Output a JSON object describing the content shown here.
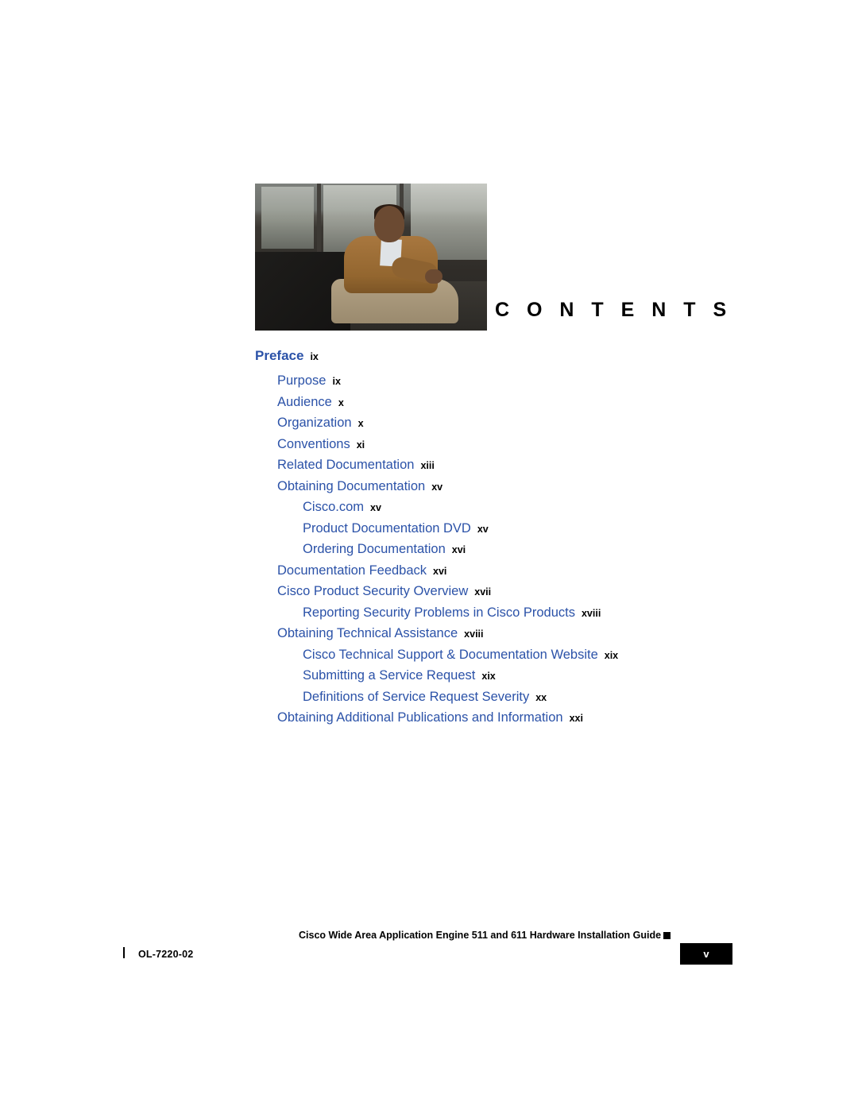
{
  "header": {
    "contents_heading": "C O N T E N T S",
    "photo_alt": "person-seated-photo"
  },
  "toc": {
    "entries": [
      {
        "title": "Preface",
        "page": "ix",
        "level": 0
      },
      {
        "title": "Purpose",
        "page": "ix",
        "level": 1
      },
      {
        "title": "Audience",
        "page": "x",
        "level": 1
      },
      {
        "title": "Organization",
        "page": "x",
        "level": 1
      },
      {
        "title": "Conventions",
        "page": "xi",
        "level": 1
      },
      {
        "title": "Related Documentation",
        "page": "xiii",
        "level": 1
      },
      {
        "title": "Obtaining Documentation",
        "page": "xv",
        "level": 1
      },
      {
        "title": "Cisco.com",
        "page": "xv",
        "level": 2
      },
      {
        "title": "Product Documentation DVD",
        "page": "xv",
        "level": 2
      },
      {
        "title": "Ordering Documentation",
        "page": "xvi",
        "level": 2
      },
      {
        "title": "Documentation Feedback",
        "page": "xvi",
        "level": 1
      },
      {
        "title": "Cisco Product Security Overview",
        "page": "xvii",
        "level": 1
      },
      {
        "title": "Reporting Security Problems in Cisco Products",
        "page": "xviii",
        "level": 2
      },
      {
        "title": "Obtaining Technical Assistance",
        "page": "xviii",
        "level": 1
      },
      {
        "title": "Cisco Technical Support & Documentation Website",
        "page": "xix",
        "level": 2
      },
      {
        "title": "Submitting a Service Request",
        "page": "xix",
        "level": 2
      },
      {
        "title": "Definitions of Service Request Severity",
        "page": "xx",
        "level": 2
      },
      {
        "title": "Obtaining Additional Publications and Information",
        "page": "xxi",
        "level": 1
      }
    ]
  },
  "footer": {
    "book_title": "Cisco Wide Area Application Engine 511 and 611 Hardware Installation Guide",
    "doc_id": "OL-7220-02",
    "page_number": "v"
  },
  "colors": {
    "link_blue": "#2b52a8",
    "text_black": "#000000",
    "page_tab": "#000000"
  }
}
